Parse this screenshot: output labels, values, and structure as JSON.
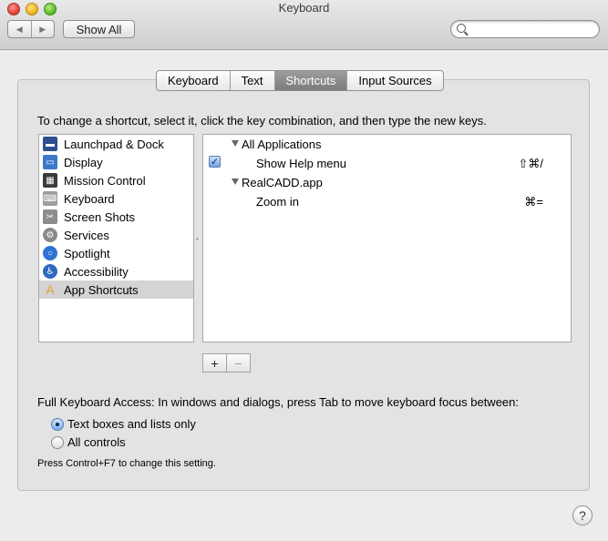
{
  "window": {
    "title": "Keyboard"
  },
  "toolbar": {
    "back_glyph": "◀",
    "forward_glyph": "▶",
    "show_all_label": "Show All",
    "search_value": ""
  },
  "tabs": [
    {
      "label": "Keyboard",
      "selected": false
    },
    {
      "label": "Text",
      "selected": false
    },
    {
      "label": "Shortcuts",
      "selected": true
    },
    {
      "label": "Input Sources",
      "selected": false
    }
  ],
  "instruction": "To change a shortcut, select it, click the key combination, and then type the new keys.",
  "categories": [
    {
      "label": "Launchpad & Dock",
      "icon": "launchpad-dock-icon",
      "color": "#2d4f8f"
    },
    {
      "label": "Display",
      "icon": "display-icon",
      "color": "#3d79c8"
    },
    {
      "label": "Mission Control",
      "icon": "mission-control-icon",
      "color": "#3b3b3b"
    },
    {
      "label": "Keyboard",
      "icon": "keyboard-icon",
      "color": "#9e9e9e"
    },
    {
      "label": "Screen Shots",
      "icon": "screenshot-icon",
      "color": "#8c8c8c"
    },
    {
      "label": "Services",
      "icon": "services-gear-icon",
      "color": "#8a8a8a"
    },
    {
      "label": "Spotlight",
      "icon": "spotlight-icon",
      "color": "#2e72d0"
    },
    {
      "label": "Accessibility",
      "icon": "accessibility-icon",
      "color": "#2f6ac2"
    },
    {
      "label": "App Shortcuts",
      "icon": "app-shortcuts-icon",
      "color": "#e5a22b",
      "selected": true
    }
  ],
  "shortcuts": {
    "group1": {
      "label": "All Applications"
    },
    "item1": {
      "label": "Show Help menu",
      "keys": "⇧⌘/",
      "checked": true
    },
    "group2": {
      "label": "RealCADD.app"
    },
    "item2": {
      "label": "Zoom in",
      "keys": "⌘="
    }
  },
  "add_remove": {
    "add": "+",
    "remove": "−"
  },
  "keyboard_access": {
    "label": "Full Keyboard Access: In windows and dialogs, press Tab to move keyboard focus between:",
    "options": [
      {
        "label": "Text boxes and lists only",
        "selected": true
      },
      {
        "label": "All controls",
        "selected": false
      }
    ],
    "hint": "Press Control+F7 to change this setting."
  },
  "help_glyph": "?"
}
